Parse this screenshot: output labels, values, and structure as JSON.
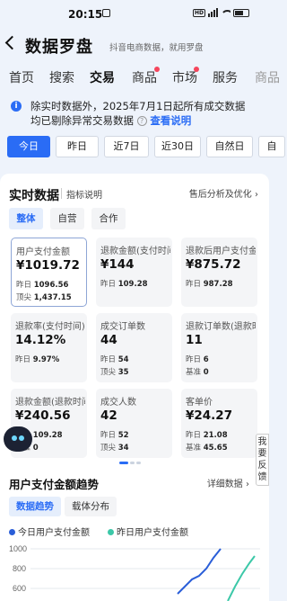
{
  "status": {
    "time": "20:15",
    "hd": "HD"
  },
  "header": {
    "title": "数据罗盘",
    "subtitle": "抖音电商数据，就用罗盘"
  },
  "tabs": [
    "首页",
    "搜索",
    "交易",
    "商品",
    "市场",
    "服务",
    "商品"
  ],
  "active_tab": "交易",
  "notice": {
    "line1": "除实时数据外，2025年7月1日起所有成交数据",
    "line2": "均已剔除异常交易数据",
    "link": "查看说明"
  },
  "date_filters": [
    "今日",
    "昨日",
    "近7日",
    "近30日",
    "自然日",
    "自"
  ],
  "realtime": {
    "title": "实时数据",
    "guide": "指标说明",
    "right_link": "售后分析及优化",
    "segments": [
      "整体",
      "自营",
      "合作"
    ],
    "metrics": [
      {
        "label": "用户支付金额",
        "value": "¥1019.72",
        "line1_label": "昨日",
        "line1_value": "1096.56",
        "line2_label": "顶尖",
        "line2_value": "1,437.15"
      },
      {
        "label": "退款金额(支付时间)",
        "value": "¥144",
        "line1_label": "昨日",
        "line1_value": "109.28",
        "line2_label": "",
        "line2_value": ""
      },
      {
        "label": "退款后用户支付金额",
        "value": "¥875.72",
        "line1_label": "昨日",
        "line1_value": "987.28",
        "line2_label": "",
        "line2_value": ""
      },
      {
        "label": "退款率(支付时间)",
        "value": "14.12%",
        "line1_label": "昨日",
        "line1_value": "9.97%",
        "line2_label": "",
        "line2_value": ""
      },
      {
        "label": "成交订单数",
        "value": "44",
        "line1_label": "昨日",
        "line1_value": "54",
        "line2_label": "顶尖",
        "line2_value": "35"
      },
      {
        "label": "退款订单数(退款时间)",
        "value": "11",
        "line1_label": "昨日",
        "line1_value": "6",
        "line2_label": "基准",
        "line2_value": "0"
      },
      {
        "label": "退款金额(退款时间)",
        "value": "¥240.56",
        "line1_label": "昨日",
        "line1_value": "109.28",
        "line2_label": "基准",
        "line2_value": "0"
      },
      {
        "label": "成交人数",
        "value": "42",
        "line1_label": "昨日",
        "line1_value": "52",
        "line2_label": "顶尖",
        "line2_value": "34"
      },
      {
        "label": "客单价",
        "value": "¥24.27",
        "line1_label": "昨日",
        "line1_value": "21.08",
        "line2_label": "基准",
        "line2_value": "45.65"
      }
    ]
  },
  "trend": {
    "title": "用户支付金额趋势",
    "link": "详细数据",
    "segments": [
      "数据趋势",
      "载体分布"
    ],
    "legend_today": "今日用户支付金额",
    "legend_yesterday": "昨日用户支付金额",
    "y_ticks": [
      "1000",
      "800",
      "600"
    ],
    "colors": {
      "today": "#2a5ed8",
      "yesterday": "#3cc8a8"
    }
  },
  "feedback": "我要反馈"
}
